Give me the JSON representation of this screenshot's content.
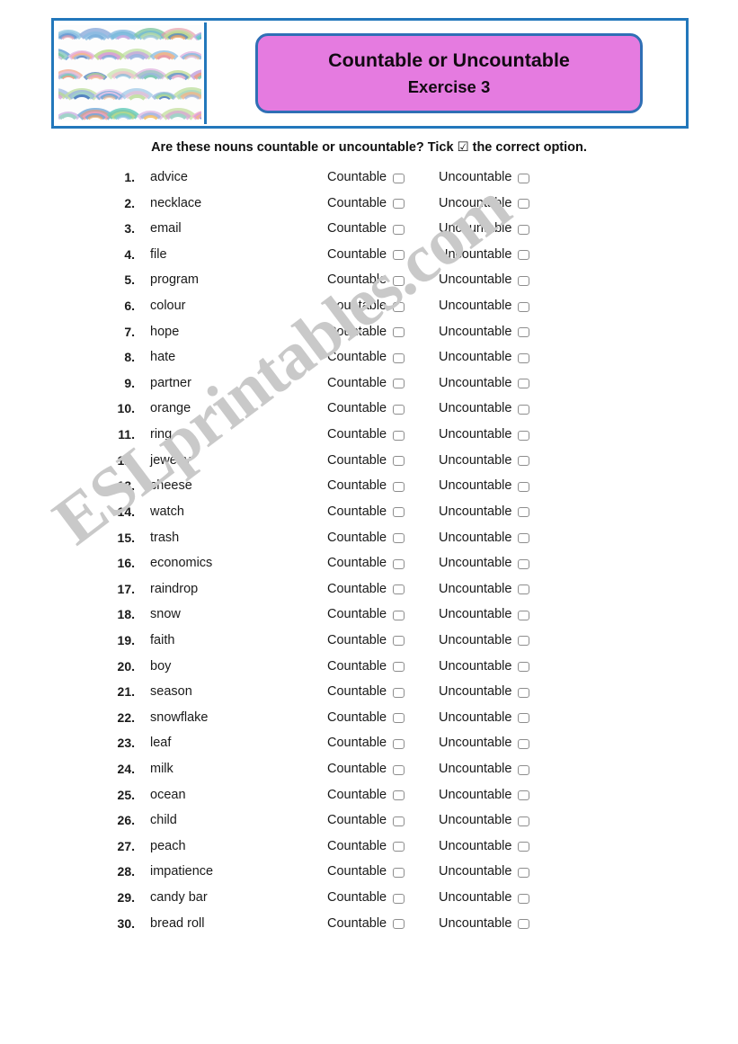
{
  "header": {
    "title_line1": "Countable or Uncountable",
    "title_line2": "Exercise 3",
    "picture_alt": "rainbow-arcs-watercolor-pattern",
    "frame_color": "#2277bb",
    "title_box_fill": "#e57be0",
    "title_box_border": "#2f6fb5"
  },
  "instruction": {
    "text_before": "Are these nouns countable or uncountable? Tick ",
    "tick": "☑",
    "text_after": " the correct option."
  },
  "options": {
    "countable_label": "Countable",
    "uncountable_label": "Uncountable"
  },
  "watermark": {
    "text": "ESLprintables.com",
    "color": "#c9c9c9"
  },
  "items": [
    {
      "number": "1.",
      "word": "advice"
    },
    {
      "number": "2.",
      "word": "necklace"
    },
    {
      "number": "3.",
      "word": "email"
    },
    {
      "number": "4.",
      "word": "file"
    },
    {
      "number": "5.",
      "word": "program"
    },
    {
      "number": "6.",
      "word": "colour"
    },
    {
      "number": "7.",
      "word": "hope"
    },
    {
      "number": "8.",
      "word": "hate"
    },
    {
      "number": "9.",
      "word": "partner"
    },
    {
      "number": "10.",
      "word": "orange"
    },
    {
      "number": "11.",
      "word": "ring"
    },
    {
      "number": "12.",
      "word": "jewelry"
    },
    {
      "number": "13.",
      "word": "cheese"
    },
    {
      "number": "14.",
      "word": "watch"
    },
    {
      "number": "15.",
      "word": "trash"
    },
    {
      "number": "16.",
      "word": "economics"
    },
    {
      "number": "17.",
      "word": "raindrop"
    },
    {
      "number": "18.",
      "word": "snow"
    },
    {
      "number": "19.",
      "word": "faith"
    },
    {
      "number": "20.",
      "word": "boy"
    },
    {
      "number": "21.",
      "word": "season"
    },
    {
      "number": "22.",
      "word": "snowflake"
    },
    {
      "number": "23.",
      "word": "leaf"
    },
    {
      "number": "24.",
      "word": "milk"
    },
    {
      "number": "25.",
      "word": "ocean"
    },
    {
      "number": "26.",
      "word": "child"
    },
    {
      "number": "27.",
      "word": "peach"
    },
    {
      "number": "28.",
      "word": "impatience"
    },
    {
      "number": "29.",
      "word": "candy bar"
    },
    {
      "number": "30.",
      "word": "bread roll"
    }
  ]
}
